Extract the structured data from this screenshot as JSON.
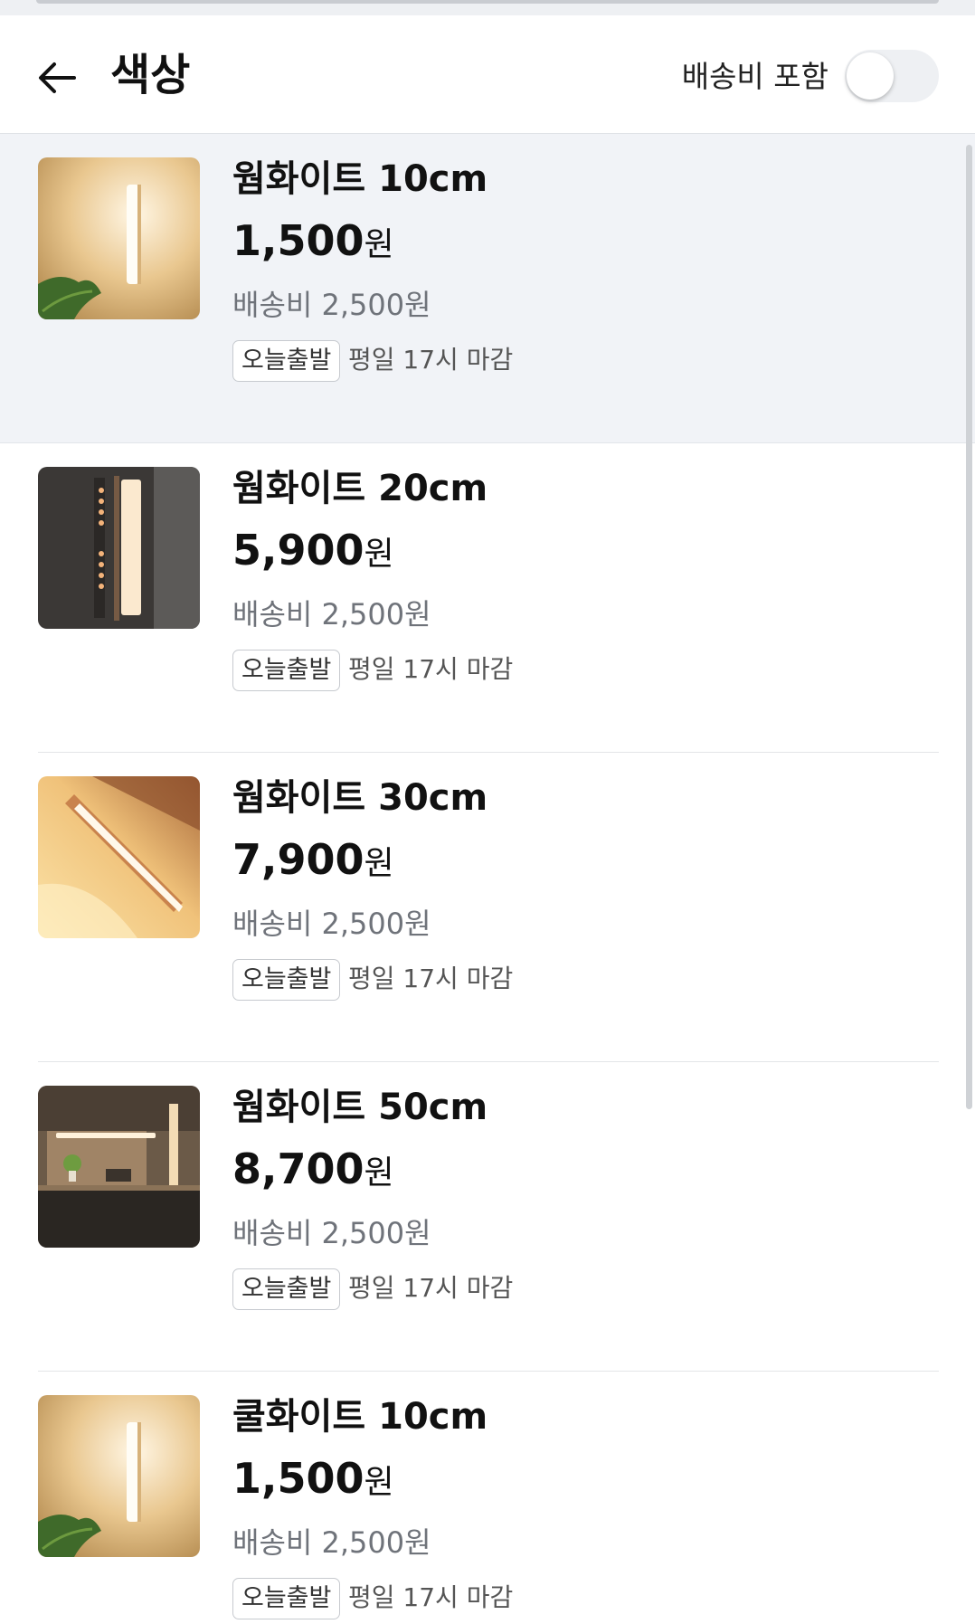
{
  "header": {
    "title": "색상",
    "toggle_label": "배송비 포함",
    "toggle_on": false
  },
  "items": [
    {
      "name": "웜화이트 10cm",
      "price": "1,500",
      "currency": "원",
      "shipping": "배송비 2,500원",
      "badge": "오늘출발",
      "deadline": "평일 17시 마감",
      "image": "warm-bar-plant"
    },
    {
      "name": "웜화이트 20cm",
      "price": "5,900",
      "currency": "원",
      "shipping": "배송비 2,500원",
      "badge": "오늘출발",
      "deadline": "평일 17시 마감",
      "image": "dark-bar-led"
    },
    {
      "name": "웜화이트 30cm",
      "price": "7,900",
      "currency": "원",
      "shipping": "배송비 2,500원",
      "badge": "오늘출발",
      "deadline": "평일 17시 마감",
      "image": "diagonal-bar"
    },
    {
      "name": "웜화이트 50cm",
      "price": "8,700",
      "currency": "원",
      "shipping": "배송비 2,500원",
      "badge": "오늘출발",
      "deadline": "평일 17시 마감",
      "image": "kitchen-cabinet"
    },
    {
      "name": "쿨화이트 10cm",
      "price": "1,500",
      "currency": "원",
      "shipping": "배송비 2,500원",
      "badge": "오늘출발",
      "deadline": "평일 17시 마감",
      "image": "warm-bar-plant"
    }
  ]
}
